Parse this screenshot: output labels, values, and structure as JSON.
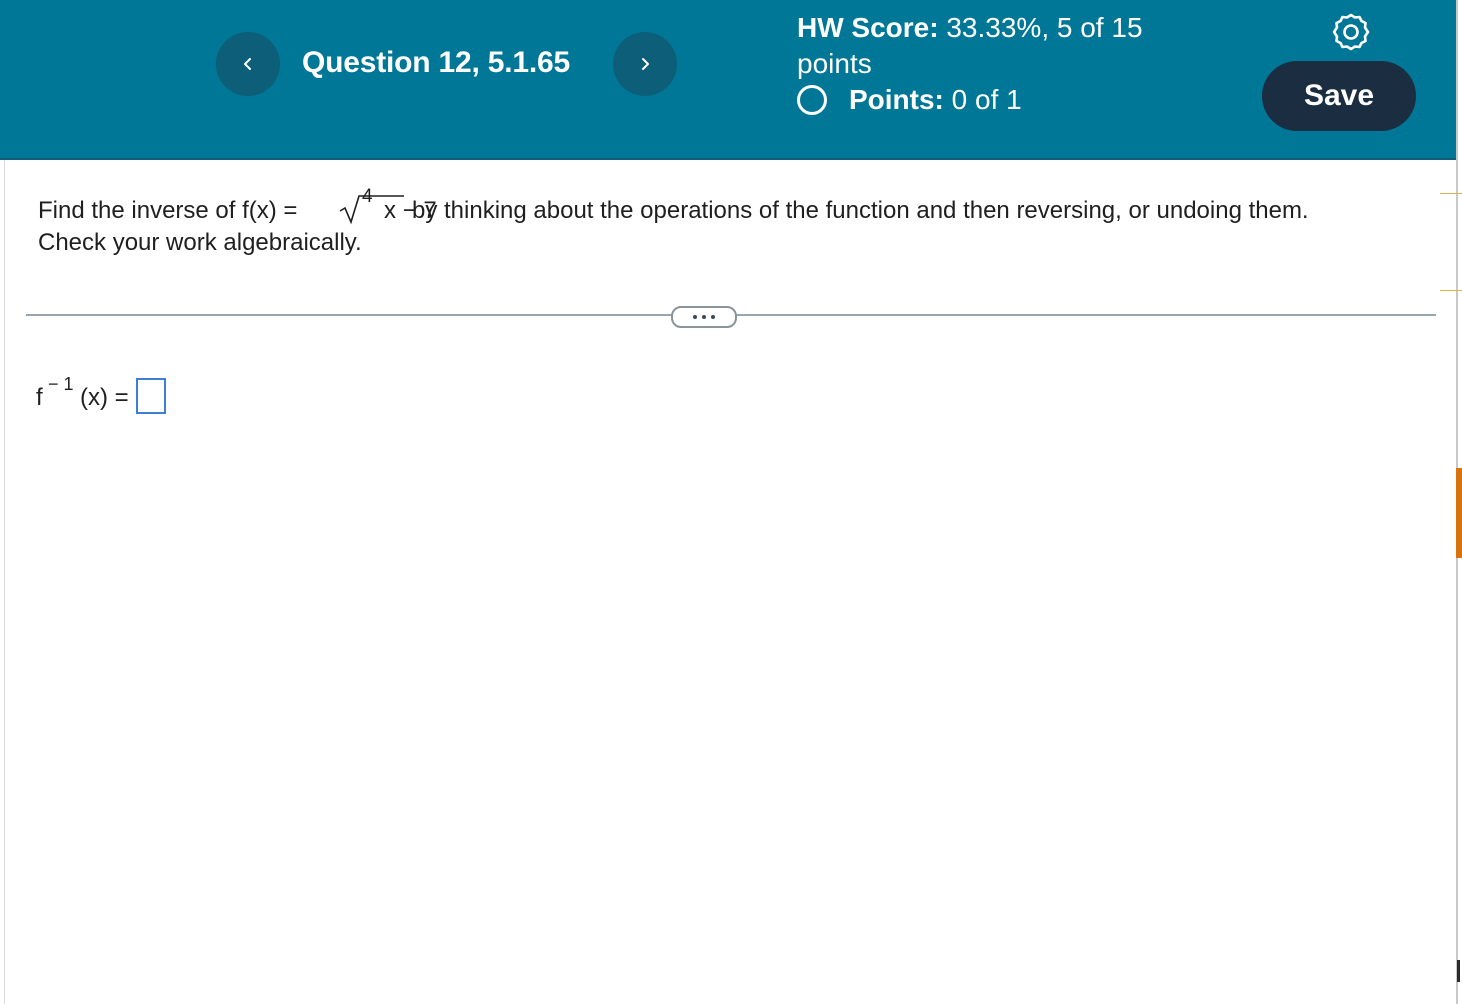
{
  "header": {
    "question_title": "Question 12, 5.1.65",
    "hw_score_label": "HW Score:",
    "hw_score_value": "33.33%, 5 of 15",
    "hw_score_unit": "points",
    "points_label": "Points:",
    "points_value": "0 of 1",
    "save_label": "Save",
    "prev_icon": "chevron-left-icon",
    "next_icon": "chevron-right-icon",
    "settings_icon": "gear-icon",
    "colors": {
      "header_bg": "#007796",
      "nav_button_bg": "#0d5e78",
      "save_bg": "#1b2d40"
    }
  },
  "problem": {
    "intro": "Find the inverse of f(x) =",
    "radical_index": "4",
    "radicand": "x − 7",
    "rest": "by thinking about the operations of the function and then reversing, or undoing them.",
    "line2": "Check your work algebraically."
  },
  "answer": {
    "func": "f",
    "superscript": "− 1",
    "rest": "(x) =",
    "value": ""
  }
}
